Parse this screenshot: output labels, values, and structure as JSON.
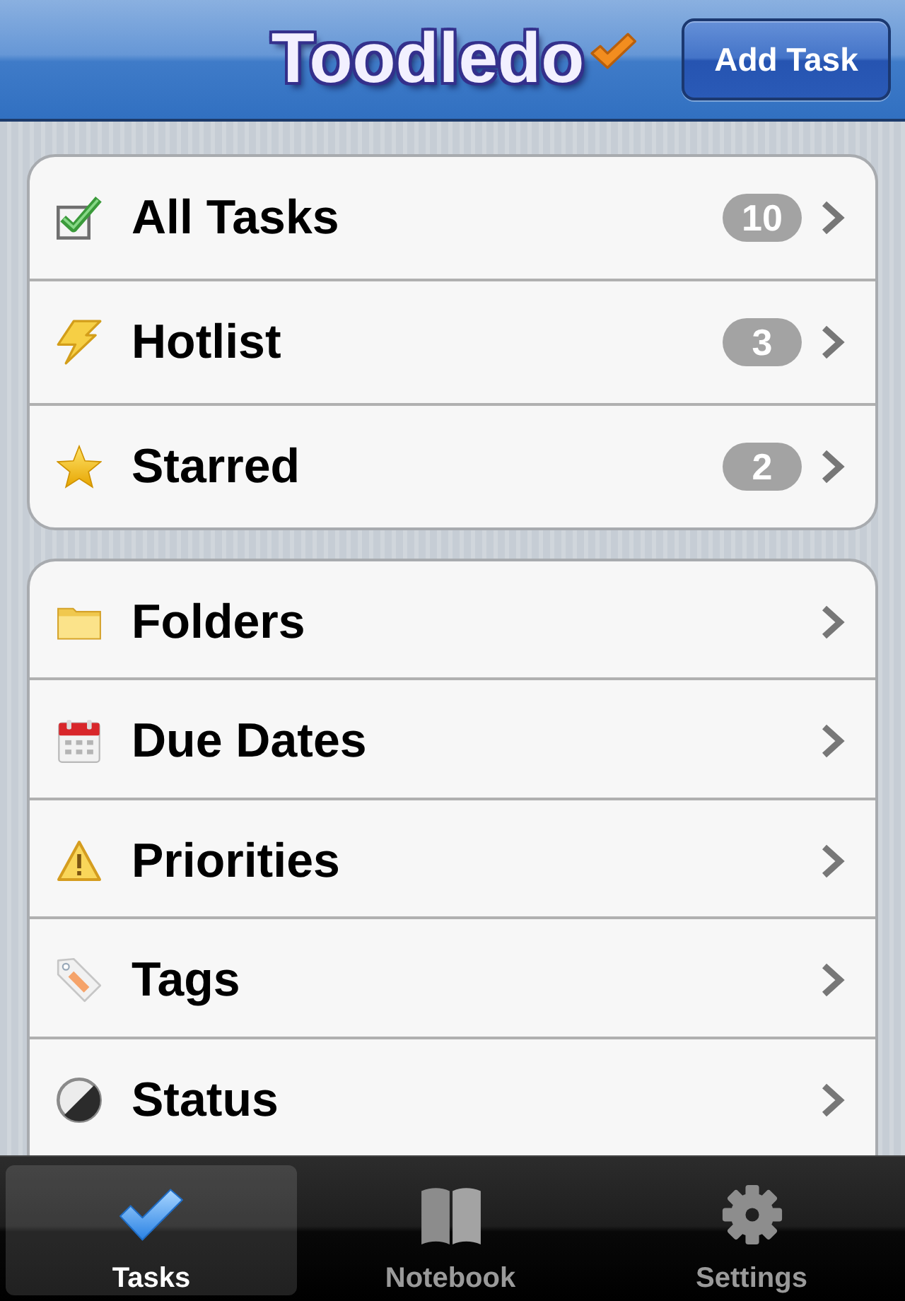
{
  "nav_bar": {
    "logo": "Toodledo",
    "button": "Add Task"
  },
  "sections": [
    {
      "items": [
        {
          "label": "All Tasks",
          "count": "10"
        },
        {
          "label": "Hotlist",
          "count": "3"
        },
        {
          "label": "Starred",
          "count": "2"
        }
      ]
    },
    {
      "items": [
        {
          "label": "Folders"
        },
        {
          "label": "Due Dates"
        },
        {
          "label": "Priorities"
        },
        {
          "label": "Tags"
        },
        {
          "label": "Status"
        }
      ]
    }
  ],
  "tab_bar": [
    {
      "label": "Tasks",
      "selected": true
    },
    {
      "label": "Notebook",
      "selected": false
    },
    {
      "label": "Settings",
      "selected": false
    }
  ]
}
